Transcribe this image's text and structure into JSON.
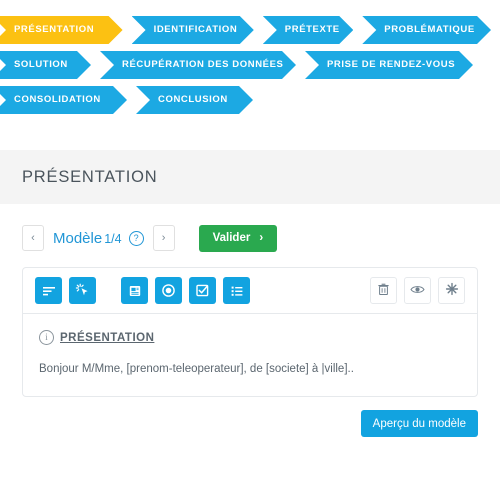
{
  "steps": {
    "rows": [
      [
        {
          "label": "PRÉSENTATION",
          "color": "#fcc112",
          "active": true,
          "width": 140
        },
        {
          "label": "IDENTIFICATION",
          "color": "#1ca9e3",
          "active": false,
          "width": 131
        },
        {
          "label": "PRÉTEXTE",
          "color": "#1ca9e3",
          "active": false,
          "width": 97
        },
        {
          "label": "PROBLÉMATIQUE",
          "color": "#1ca9e3",
          "active": false,
          "width": 138
        }
      ],
      [
        {
          "label": "SOLUTION",
          "color": "#1ca9e3",
          "active": false,
          "width": 99
        },
        {
          "label": "RÉCUPÉRATION DES DONNÉES",
          "color": "#1ca9e3",
          "active": false,
          "width": 196
        },
        {
          "label": "PRISE DE RENDEZ-VOUS",
          "color": "#1ca9e3",
          "active": false,
          "width": 168
        }
      ],
      [
        {
          "label": "CONSOLIDATION",
          "color": "#1ca9e3",
          "active": false,
          "width": 135
        },
        {
          "label": "CONCLUSION",
          "color": "#1ca9e3",
          "active": false,
          "width": 117
        }
      ]
    ]
  },
  "section": {
    "title": "PRÉSENTATION"
  },
  "pager": {
    "prev_label": "‹",
    "next_label": "›",
    "model_label": "Modèle",
    "model_fraction": "1/4",
    "help_label": "?",
    "validate_label": "Valider",
    "validate_arrow": "›"
  },
  "toolbar": {
    "left_tools": [
      {
        "icon": "align-left-icon",
        "name": "align-text-button"
      },
      {
        "icon": "cursor-sparkle-icon",
        "name": "insert-variable-button"
      }
    ],
    "mid_tools": [
      {
        "icon": "text-block-icon",
        "name": "text-block-button"
      },
      {
        "icon": "radio-circle-icon",
        "name": "radio-block-button"
      },
      {
        "icon": "checkbox-icon",
        "name": "checkbox-block-button"
      },
      {
        "icon": "list-icon",
        "name": "list-block-button"
      }
    ],
    "right_tools": [
      {
        "icon": "trash-icon",
        "name": "delete-button"
      },
      {
        "icon": "eye-icon",
        "name": "preview-eye-button"
      },
      {
        "icon": "asterisk-icon",
        "name": "required-button"
      }
    ]
  },
  "block": {
    "info_glyph": "i",
    "title": "PRÉSENTATION",
    "text": "Bonjour M/Mme, [prenom-teleoperateur], de [societe] à |ville].."
  },
  "footer": {
    "preview_label": "Aperçu du modèle"
  },
  "colors": {
    "brand_blue": "#12a3e0",
    "step_blue": "#1ca9e3",
    "active_yellow": "#fcc112",
    "validate_green": "#2aa94f",
    "band_gray": "#f4f4f4",
    "text_gray": "#5b666f"
  }
}
